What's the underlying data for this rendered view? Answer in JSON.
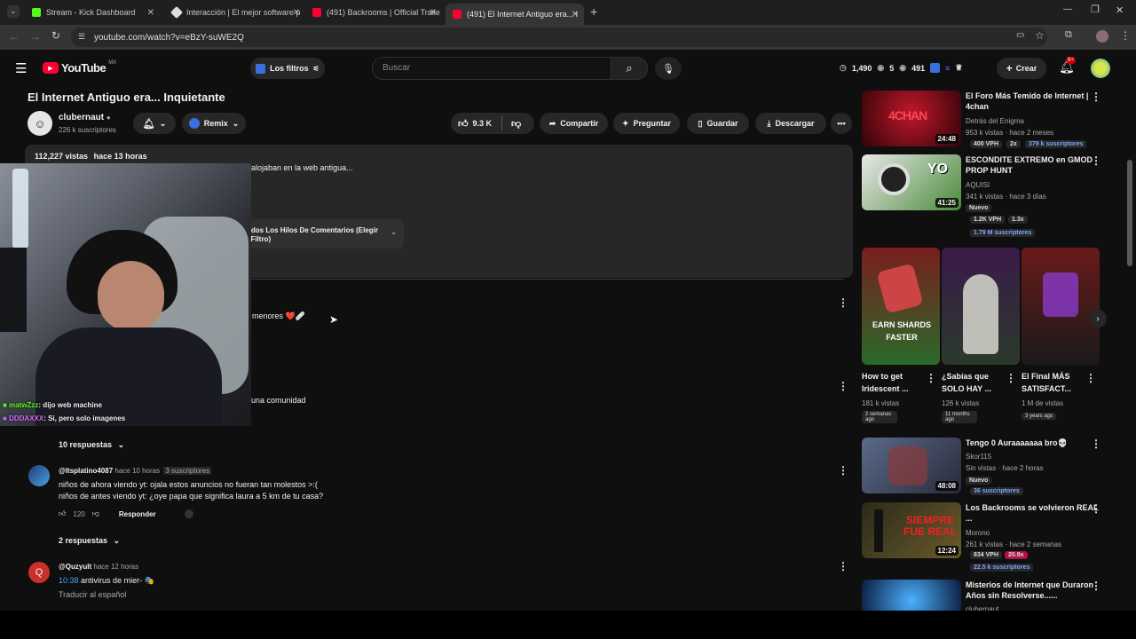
{
  "browser": {
    "tabs": [
      {
        "label": "Stream - Kick Dashboard",
        "color": "#53fc18"
      },
      {
        "label": "Interacción | El mejor software p",
        "color": "#ffffff"
      },
      {
        "label": "(491) Backrooms | Official Traile",
        "color": "#ff0033"
      },
      {
        "label": "(491) El Internet Antiguo era... I",
        "color": "#ff0033"
      }
    ],
    "url": "youtube.com/watch?v=eBzY-suWE2Q"
  },
  "header": {
    "logo": "YouTube",
    "region": "MX",
    "filters_label": "Los filtros",
    "search_placeholder": "Buscar",
    "stats": [
      "1,490",
      "5",
      "491"
    ],
    "create_label": "Crear",
    "notif_count": "9+"
  },
  "video": {
    "title": "El Internet Antiguo era... Inquietante",
    "channel": "clubernaut",
    "subs": "226 k suscriptores",
    "remix": "Remix",
    "likes": "9.3 K",
    "share": "Compartir",
    "ask": "Preguntar",
    "save": "Guardar",
    "download": "Descargar",
    "views": "112,227 vistas",
    "age": "hace 13 horas",
    "desc_snippet": "alojaban en la web antigua...",
    "filter_label": "odos Los Hilos De Comentarios (Elegir",
    "filter_label2": "l Filtro)"
  },
  "stream_overlay": {
    "chat": [
      {
        "user": "matwZzz",
        "msg": ": dijo web machine"
      },
      {
        "user": "DDDAXXX",
        "msg": ": Si, pero solo imagenes"
      }
    ]
  },
  "comments": {
    "partial1": "menores ❤️🩹",
    "partial2": "una comunidad",
    "replies1": "10 respuestas",
    "c2_user": "@Itsplatino4087",
    "c2_age": "hace 10 horas",
    "c2_badge": "3 suscriptores",
    "c2_line1": "niños de ahora viendo yt: ojala estos anuncios no fueran tan molestos >:(",
    "c2_line2": "niños de antes viendo yt: ¿oye papa que significa laura a 5 km de tu casa?",
    "c2_likes": "120",
    "reply_label": "Responder",
    "replies2": "2 respuestas",
    "c3_avatar": "Q",
    "c3_user": "@Quzyult",
    "c3_age": "hace 12 horas",
    "c3_time": "10:38",
    "c3_text": "antivirus de mier- 🎭",
    "c3_translate": "Traducir al español"
  },
  "recs": [
    {
      "title": "El Foro Más Temido de Internet | 4chan",
      "channel": "Detrás del Enigma",
      "meta": "953 k vistas · hace 2 meses",
      "dur": "24:48",
      "vph": "400 VPH",
      "mult": "2x",
      "subs": "379 k suscriptores",
      "thumb_text": "4CHAN"
    },
    {
      "title": "ESCONDITE EXTREMO en GMOD PROP HUNT",
      "channel": "AQUISI",
      "meta": "341 k vistas · hace 3 días",
      "dur": "41:25",
      "new": "Nuevo",
      "vph": "1.2K VPH",
      "mult": "1.3x",
      "subs": "1.79 M suscriptores",
      "thumb_text": "YO"
    },
    {
      "title": "Tengo 0 Auraaaaaaa bro💀",
      "channel": "Skor115",
      "meta": "Sin vistas · hace 2 horas",
      "dur": "48:08",
      "new": "Nuevo",
      "subs": "36 suscriptores"
    },
    {
      "title": "Los Backrooms se volvieron REAL ...",
      "channel": "Morono",
      "meta": "261 k vistas · hace 2 semanas",
      "dur": "12:24",
      "vph": "834 VPH",
      "mult": "20.9x",
      "subs": "22.5 k suscriptores",
      "thumb_text": "SIEMPRE FUE REAL"
    },
    {
      "title": "Misterios de Internet que Duraron Años sin Resolverse......",
      "channel": "clubernaut"
    }
  ],
  "shorts": [
    {
      "title": "How to get Iridescent ...",
      "views": "181 k vistas",
      "age": "2 semanas ago",
      "thumb_text": "EARN SHARDS FASTER"
    },
    {
      "title": "¿Sabías que SOLO HAY ...",
      "views": "126 k vistas",
      "age": "11 months ago"
    },
    {
      "title": "El Final MÁS SATISFACT...",
      "views": "1 M de vistas",
      "age": "3 years ago"
    }
  ]
}
